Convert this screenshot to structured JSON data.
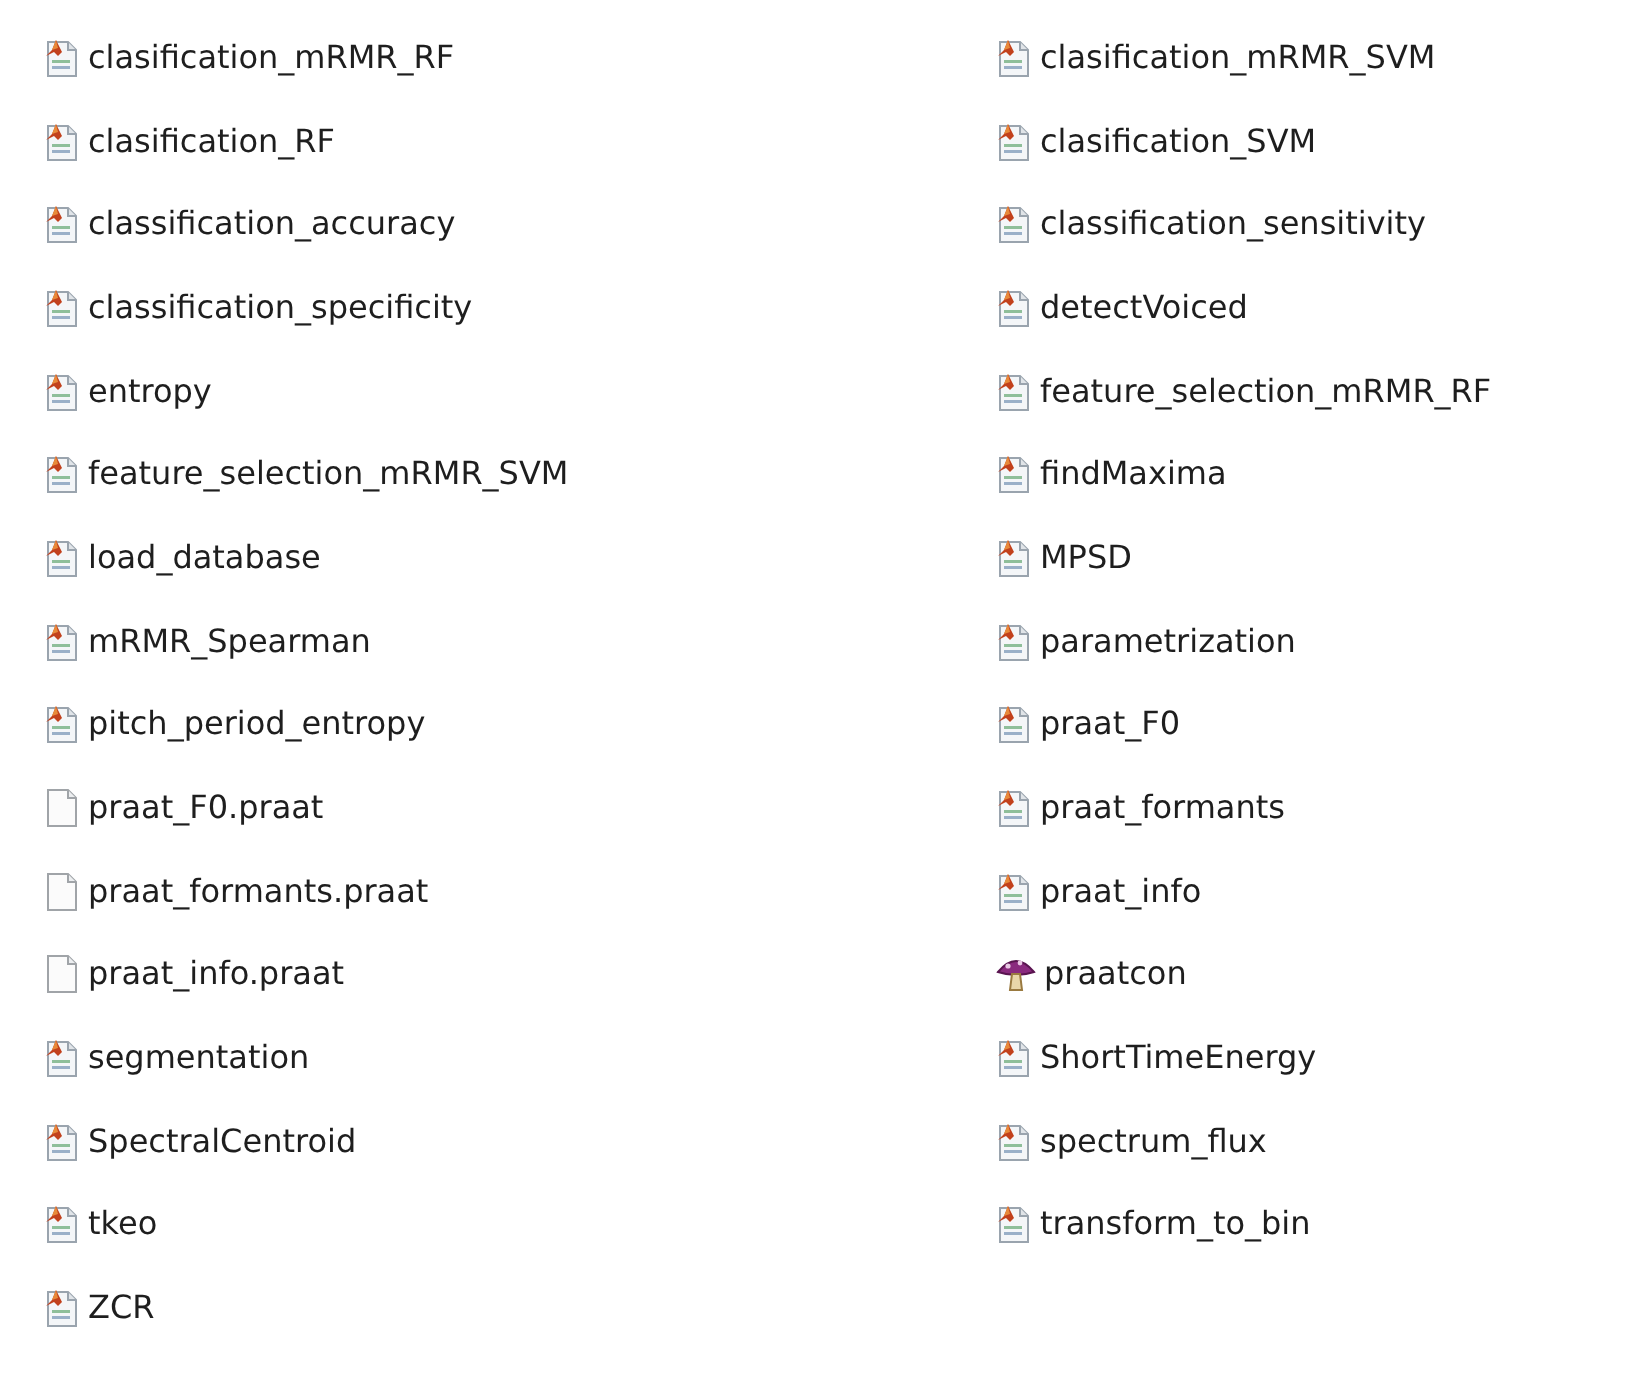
{
  "files": [
    {
      "name": "clasification_mRMR_RF",
      "kind": "matlab"
    },
    {
      "name": "clasification_mRMR_SVM",
      "kind": "matlab"
    },
    {
      "name": "clasification_RF",
      "kind": "matlab"
    },
    {
      "name": "clasification_SVM",
      "kind": "matlab"
    },
    {
      "name": "classification_accuracy",
      "kind": "matlab"
    },
    {
      "name": "classification_sensitivity",
      "kind": "matlab"
    },
    {
      "name": "classification_specificity",
      "kind": "matlab"
    },
    {
      "name": "detectVoiced",
      "kind": "matlab"
    },
    {
      "name": "entropy",
      "kind": "matlab"
    },
    {
      "name": "feature_selection_mRMR_RF",
      "kind": "matlab"
    },
    {
      "name": "feature_selection_mRMR_SVM",
      "kind": "matlab"
    },
    {
      "name": "findMaxima",
      "kind": "matlab"
    },
    {
      "name": "load_database",
      "kind": "matlab"
    },
    {
      "name": "MPSD",
      "kind": "matlab"
    },
    {
      "name": "mRMR_Spearman",
      "kind": "matlab"
    },
    {
      "name": "parametrization",
      "kind": "matlab"
    },
    {
      "name": "pitch_period_entropy",
      "kind": "matlab"
    },
    {
      "name": "praat_F0",
      "kind": "matlab"
    },
    {
      "name": "praat_F0.praat",
      "kind": "blank"
    },
    {
      "name": "praat_formants",
      "kind": "matlab"
    },
    {
      "name": "praat_formants.praat",
      "kind": "blank"
    },
    {
      "name": "praat_info",
      "kind": "matlab"
    },
    {
      "name": "praat_info.praat",
      "kind": "blank"
    },
    {
      "name": "praatcon",
      "kind": "app"
    },
    {
      "name": "segmentation",
      "kind": "matlab"
    },
    {
      "name": "ShortTimeEnergy",
      "kind": "matlab"
    },
    {
      "name": "SpectralCentroid",
      "kind": "matlab"
    },
    {
      "name": "spectrum_flux",
      "kind": "matlab"
    },
    {
      "name": "tkeo",
      "kind": "matlab"
    },
    {
      "name": "transform_to_bin",
      "kind": "matlab"
    },
    {
      "name": "ZCR",
      "kind": "matlab"
    }
  ]
}
